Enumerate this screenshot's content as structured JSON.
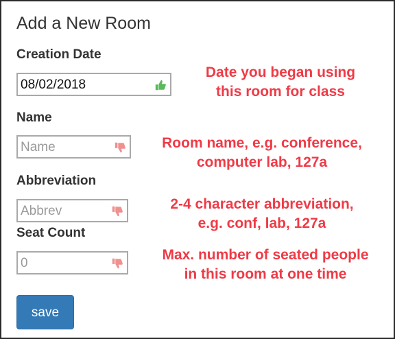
{
  "form": {
    "title": "Add a New Room",
    "creation_date": {
      "label": "Creation Date",
      "value": "08/02/2018",
      "status_icon": "thumbs-up-icon",
      "hint_line1": "Date you began using",
      "hint_line2": "this room for class"
    },
    "name": {
      "label": "Name",
      "placeholder": "Name",
      "status_icon": "thumbs-down-icon",
      "hint_line1": "Room name, e.g. conference,",
      "hint_line2": "computer lab, 127a"
    },
    "abbreviation": {
      "label": "Abbreviation",
      "placeholder": "Abbrev",
      "status_icon": "thumbs-down-icon",
      "hint_line1": "2-4 character abbreviation,",
      "hint_line2": "e.g. conf, lab, 127a"
    },
    "seat_count": {
      "label": "Seat Count",
      "placeholder": "0",
      "status_icon": "thumbs-down-icon",
      "hint_line1": "Max. number of seated people",
      "hint_line2": "in this room at one time"
    },
    "save_label": "save"
  },
  "colors": {
    "hint_red": "#ef3a46",
    "valid_green": "#5cb85c",
    "invalid_pink": "#f0908f",
    "button_blue": "#337ab7"
  }
}
